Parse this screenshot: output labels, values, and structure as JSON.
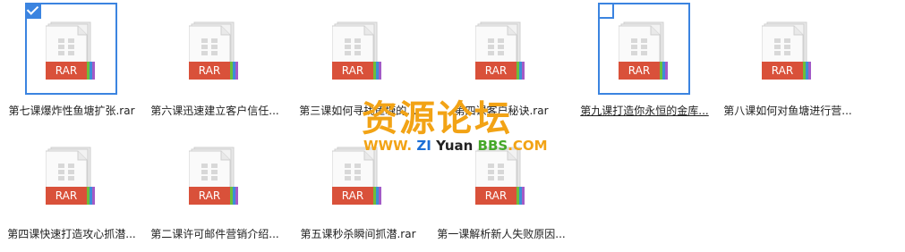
{
  "files": [
    {
      "name": "第七课爆炸性鱼塘扩张.rar",
      "badge": "RAR",
      "state": "selected"
    },
    {
      "name": "第六课迅速建立客户信任...",
      "badge": "RAR",
      "state": "normal"
    },
    {
      "name": "第三课如何寻找鱼塘的...",
      "badge": "RAR",
      "state": "normal"
    },
    {
      "name": "第四课客户秘诀.rar",
      "badge": "RAR",
      "state": "normal"
    },
    {
      "name": "第九课打造你永恒的金库...",
      "badge": "RAR",
      "state": "hover"
    },
    {
      "name": "第八课如何对鱼塘进行营...",
      "badge": "RAR",
      "state": "normal"
    },
    {
      "name": "第四课快速打造攻心抓潜...",
      "badge": "RAR",
      "state": "normal"
    },
    {
      "name": "第二课许可邮件营销介绍...",
      "badge": "RAR",
      "state": "normal"
    },
    {
      "name": "第五课秒杀瞬间抓潜.rar",
      "badge": "RAR",
      "state": "normal"
    },
    {
      "name": "第一课解析新人失败原因...",
      "badge": "RAR",
      "state": "normal"
    }
  ],
  "watermark": {
    "title": "资源论坛",
    "www": "WWW.",
    "zi": "ZI",
    "yuan": "Yuan",
    "bbs": "BBS",
    "com": ".COM"
  },
  "colors": {
    "accent": "#3b84e0",
    "rar_badge": "#d9513a",
    "watermark_orange": "#f2a315"
  },
  "icons": {
    "file": "rar-archive-icon",
    "checkbox": "checkbox-icon"
  }
}
